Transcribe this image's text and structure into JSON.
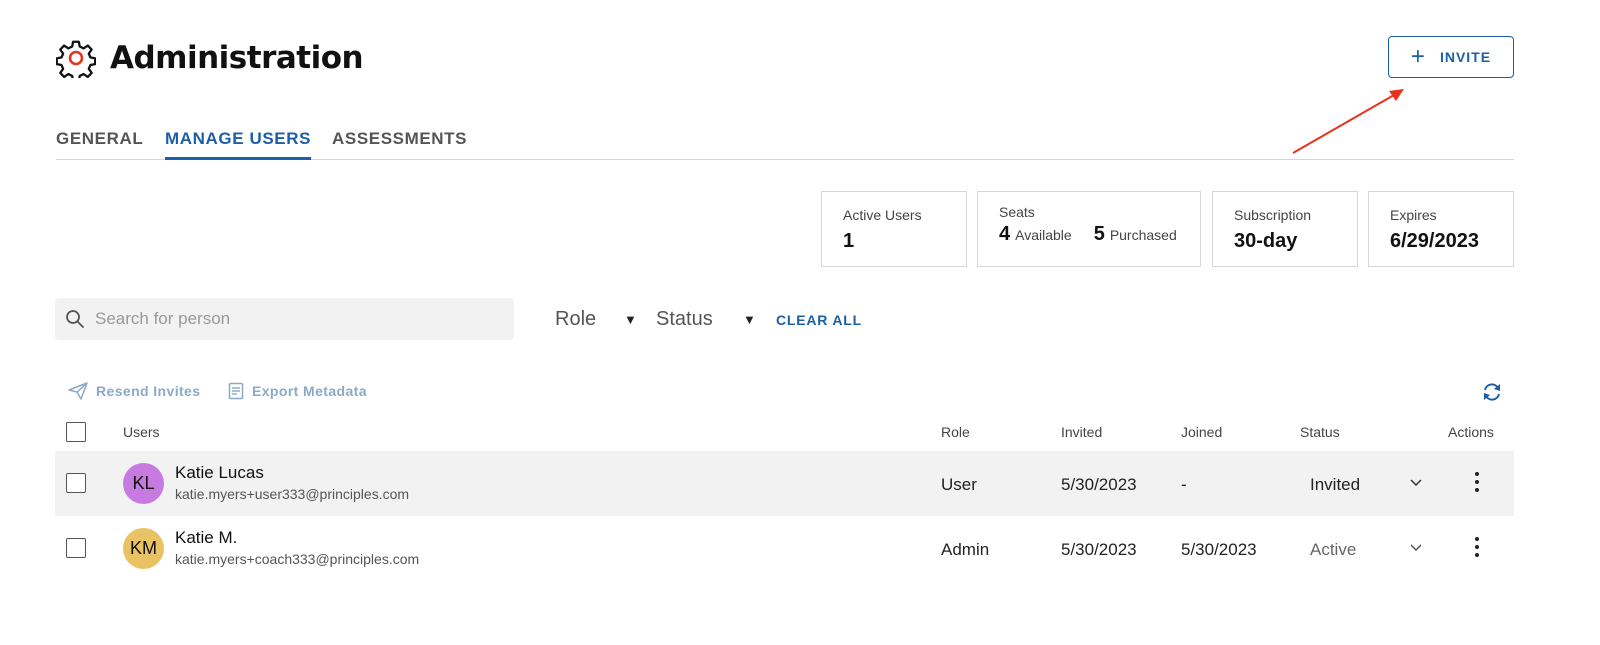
{
  "header": {
    "title": "Administration",
    "icon": "gear-icon",
    "invite_label": "INVITE",
    "invite_icon": "plus-icon"
  },
  "tabs": [
    {
      "label": "GENERAL",
      "active": false
    },
    {
      "label": "MANAGE USERS",
      "active": true
    },
    {
      "label": "ASSESSMENTS",
      "active": false
    }
  ],
  "stats": {
    "active_users": {
      "label": "Active Users",
      "value": "1"
    },
    "seats": {
      "label": "Seats",
      "available_value": "4",
      "available_label": "Available",
      "purchased_value": "5",
      "purchased_label": "Purchased"
    },
    "subscription": {
      "label": "Subscription",
      "value": "30-day"
    },
    "expires": {
      "label": "Expires",
      "value": "6/29/2023"
    }
  },
  "filters": {
    "search_placeholder": "Search for person",
    "role_label": "Role",
    "status_label": "Status",
    "clear_all": "CLEAR ALL"
  },
  "bulk_actions": {
    "resend": "Resend Invites",
    "export": "Export Metadata"
  },
  "table": {
    "columns": {
      "users": "Users",
      "role": "Role",
      "invited": "Invited",
      "joined": "Joined",
      "status": "Status",
      "actions": "Actions"
    },
    "rows": [
      {
        "initials": "KL",
        "avatar_color": "#c77be0",
        "name": "Katie Lucas",
        "email": "katie.myers+user333@principles.com",
        "role": "User",
        "invited": "5/30/2023",
        "joined": "-",
        "status": "Invited"
      },
      {
        "initials": "KM",
        "avatar_color": "#e9c263",
        "name": "Katie M.",
        "email": "katie.myers+coach333@principles.com",
        "role": "Admin",
        "invited": "5/30/2023",
        "joined": "5/30/2023",
        "status": "Active"
      }
    ]
  },
  "colors": {
    "accent": "#1d5fa6",
    "annotation_arrow": "#e8321e",
    "muted_action": "#8aaac7"
  }
}
